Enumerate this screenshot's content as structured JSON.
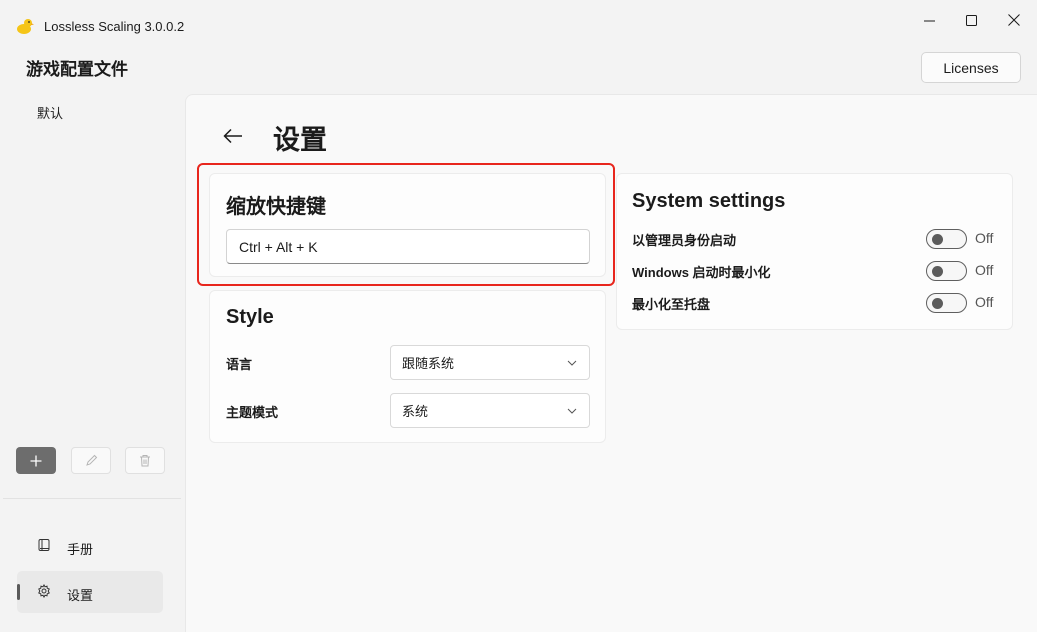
{
  "window": {
    "title": "Lossless Scaling 3.0.0.2"
  },
  "header": {
    "profiles_title": "游戏配置文件",
    "licenses_label": "Licenses"
  },
  "sidebar": {
    "profiles": [
      "默认"
    ],
    "nav": [
      {
        "label": "手册",
        "icon": "book-icon"
      },
      {
        "label": "设置",
        "icon": "gear-icon",
        "selected": true
      }
    ]
  },
  "page": {
    "title": "设置"
  },
  "hotkey": {
    "title": "缩放快捷键",
    "value": "Ctrl + Alt + K"
  },
  "style": {
    "title": "Style",
    "language_label": "语言",
    "language_value": "跟随系统",
    "theme_label": "主题模式",
    "theme_value": "系统"
  },
  "system": {
    "title": "System settings",
    "items": [
      {
        "label": "以管理员身份启动",
        "state": "Off"
      },
      {
        "label": "Windows 启动时最小化",
        "state": "Off"
      },
      {
        "label": "最小化至托盘",
        "state": "Off"
      }
    ]
  },
  "colors": {
    "highlight": "#e8261d",
    "accent_dark": "#5c5c5c"
  }
}
